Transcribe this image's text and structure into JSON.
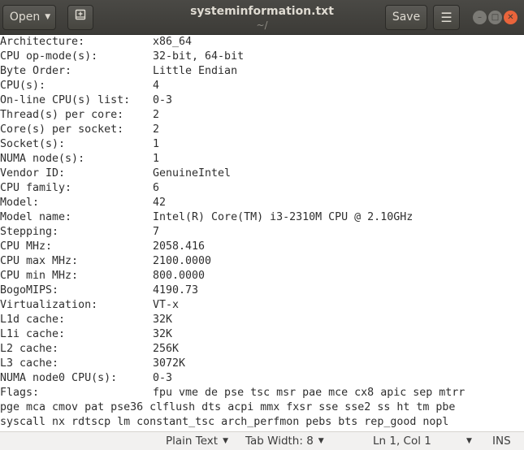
{
  "header": {
    "open_label": "Open",
    "title": "systeminformation.txt",
    "subtitle": "~/",
    "save_label": "Save"
  },
  "icons": {
    "open_dropdown": "chevron-down-icon",
    "new_tab": "new-document-icon",
    "menu": "hamburger-menu-icon",
    "minimize": "minimize-icon",
    "maximize": "maximize-icon",
    "close": "close-icon"
  },
  "colors": {
    "headerbar": "#3c3b37",
    "close_button": "#e9643b",
    "statusbar": "#f2f1f0"
  },
  "document": {
    "lines": [
      {
        "key": "Architecture:",
        "value": "x86_64"
      },
      {
        "key": "CPU op-mode(s):",
        "value": "32-bit, 64-bit"
      },
      {
        "key": "Byte Order:",
        "value": "Little Endian"
      },
      {
        "key": "CPU(s):",
        "value": "4"
      },
      {
        "key": "On-line CPU(s) list:",
        "value": "0-3"
      },
      {
        "key": "Thread(s) per core:",
        "value": "2"
      },
      {
        "key": "Core(s) per socket:",
        "value": "2"
      },
      {
        "key": "Socket(s):",
        "value": "1"
      },
      {
        "key": "NUMA node(s):",
        "value": "1"
      },
      {
        "key": "Vendor ID:",
        "value": "GenuineIntel"
      },
      {
        "key": "CPU family:",
        "value": "6"
      },
      {
        "key": "Model:",
        "value": "42"
      },
      {
        "key": "Model name:",
        "value": "Intel(R) Core(TM) i3-2310M CPU @ 2.10GHz"
      },
      {
        "key": "Stepping:",
        "value": "7"
      },
      {
        "key": "CPU MHz:",
        "value": "2058.416"
      },
      {
        "key": "CPU max MHz:",
        "value": "2100.0000"
      },
      {
        "key": "CPU min MHz:",
        "value": "800.0000"
      },
      {
        "key": "BogoMIPS:",
        "value": "4190.73"
      },
      {
        "key": "Virtualization:",
        "value": "VT-x"
      },
      {
        "key": "L1d cache:",
        "value": "32K"
      },
      {
        "key": "L1i cache:",
        "value": "32K"
      },
      {
        "key": "L2 cache:",
        "value": "256K"
      },
      {
        "key": "L3 cache:",
        "value": "3072K"
      },
      {
        "key": "NUMA node0 CPU(s):",
        "value": "0-3"
      },
      {
        "key": "Flags:",
        "value": "fpu vme de pse tsc msr pae mce cx8 apic sep mtrr"
      }
    ],
    "wrap_lines": [
      "pge mca cmov pat pse36 clflush dts acpi mmx fxsr sse sse2 ss ht tm pbe",
      "syscall nx rdtscp lm constant_tsc arch_perfmon pebs bts rep_good nopl"
    ]
  },
  "statusbar": {
    "language": "Plain Text",
    "tab_width": "Tab Width: 8",
    "position": "Ln 1, Col 1",
    "mode": "INS"
  }
}
